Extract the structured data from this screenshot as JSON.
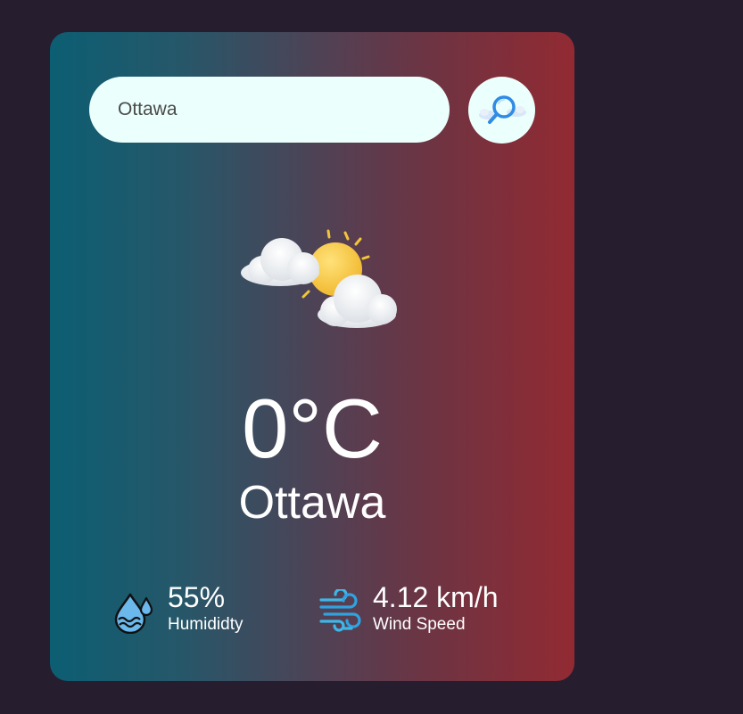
{
  "search": {
    "value": "Ottawa",
    "button_icon": "search-icon"
  },
  "weather": {
    "icon": "partly-cloudy-icon",
    "temperature": "0°C",
    "city": "Ottawa"
  },
  "details": {
    "humidity": {
      "value": "55%",
      "label": "Humididty",
      "icon": "humidity-icon"
    },
    "wind": {
      "value": "4.12 km/h",
      "label": "Wind Speed",
      "icon": "wind-icon"
    }
  },
  "colors": {
    "background": "#261e2f",
    "gradient_start": "#0c5e73",
    "gradient_end": "#922a32",
    "input_bg": "#ebfffc"
  }
}
